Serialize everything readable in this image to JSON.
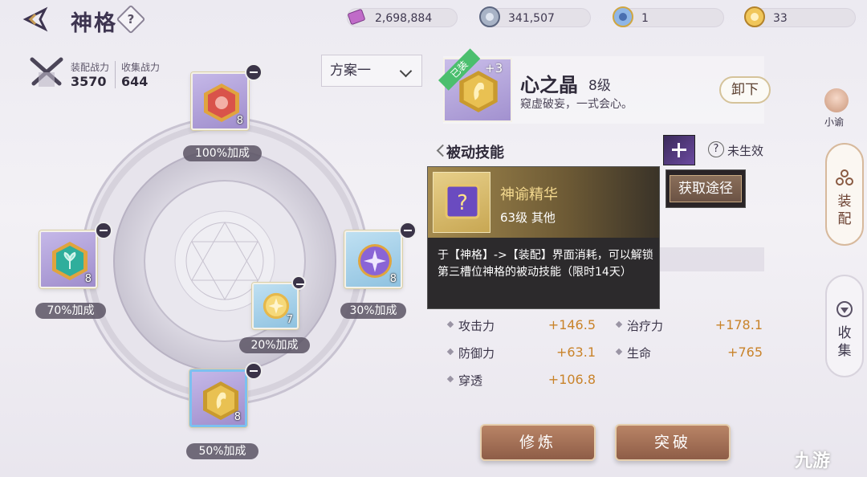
{
  "header": {
    "title": "神格",
    "help": "?"
  },
  "resources": [
    {
      "icon": "purple-crystal-icon",
      "value": "2,698,884"
    },
    {
      "icon": "silver-coin-icon",
      "value": "341,507"
    },
    {
      "icon": "blue-token-icon",
      "value": "1"
    },
    {
      "icon": "gold-token-icon",
      "value": "33"
    }
  ],
  "power": {
    "equip_label": "装配战力",
    "equip_value": "3570",
    "collect_label": "收集战力",
    "collect_value": "644"
  },
  "plan": {
    "selected": "方案一"
  },
  "slots": [
    {
      "name": "top",
      "level": "8",
      "bonus": "100%加成",
      "gem": "red-wolf-gem"
    },
    {
      "name": "left",
      "level": "8",
      "bonus": "70%加成",
      "gem": "green-leaf-gem"
    },
    {
      "name": "right",
      "level": "8",
      "bonus": "30%加成",
      "gem": "purple-star-gem"
    },
    {
      "name": "inner",
      "level": "7",
      "bonus": "20%加成",
      "gem": "gold-sun-gem"
    },
    {
      "name": "bottom",
      "level": "8",
      "bonus": "50%加成",
      "gem": "gold-crystal-gem"
    }
  ],
  "equipped": {
    "tag": "已装",
    "plus": "+3",
    "name": "心之晶",
    "level": "8级",
    "desc": "窥虚破妄，一式会心。",
    "unequip": "卸下"
  },
  "skill": {
    "section": "被动技能",
    "status": "未生效"
  },
  "tooltip": {
    "name": "神谕精华",
    "sub": "63级 其他",
    "body": "于【神格】->【装配】界面消耗，可以解锁第三槽位神格的被动技能（限时14天）",
    "obtain": "获取途径"
  },
  "stats": [
    {
      "label": "攻击力",
      "value": "+146.5"
    },
    {
      "label": "治疗力",
      "value": "+178.1"
    },
    {
      "label": "防御力",
      "value": "+63.1"
    },
    {
      "label": "生命",
      "value": "+765"
    },
    {
      "label": "穿透",
      "value": "+106.8"
    }
  ],
  "buttons": {
    "cultivate": "修炼",
    "breakthrough": "突破"
  },
  "side": {
    "avatar_label": "小谕",
    "equip": "装配",
    "collect": "收集"
  },
  "watermark": "九游",
  "colors": {
    "accent": "#c9832a",
    "button": "#9a6a52",
    "tooltip": "#2c2a2c"
  }
}
